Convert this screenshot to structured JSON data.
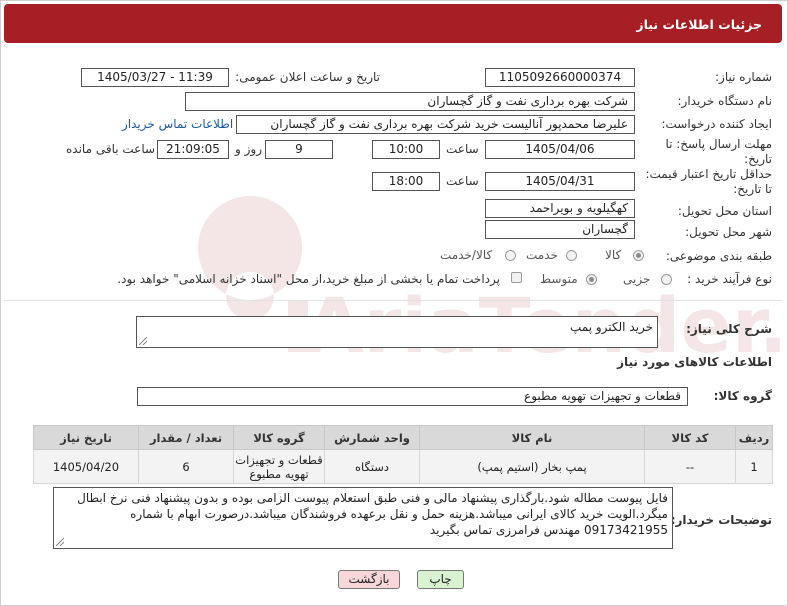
{
  "header": {
    "title": "جزئیات اطلاعات نیاز"
  },
  "labels": {
    "need_number": "شماره نیاز:",
    "announce_datetime": "تاریخ و ساعت اعلان عمومی:",
    "buyer_org": "نام دستگاه خریدار:",
    "creator": "ایجاد کننده درخواست:",
    "reply_deadline": "مهلت ارسال پاسخ: تا تاریخ:",
    "price_validity": "حداقل تاریخ اعتبار قیمت: تا تاریخ:",
    "hour": "ساعت",
    "day_and": "روز و",
    "remaining_hours": "ساعت باقی مانده",
    "province": "استان محل تحویل:",
    "city": "شهر محل تحویل:",
    "category": "طبقه بندی موضوعی:",
    "purchase_type": "نوع فرآیند خرید :",
    "description": "شرح کلی نیاز:",
    "goods_info": "اطلاعات کالاهای مورد نیاز",
    "goods_group": "گروه کالا:",
    "buyer_notes": "توضیحات خریدار:"
  },
  "values": {
    "need_number": "1105092660000374",
    "announce_datetime": "1405/03/27 - 11:39",
    "buyer_org": "شرکت بهره برداری نفت و گاز گچساران",
    "creator": "علیرضا محمدپور آنالیست خرید شرکت بهره برداری نفت و گاز گچساران",
    "buyer_contact_link": "اطلاعات تماس خریدار",
    "reply_date": "1405/04/06",
    "reply_time": "10:00",
    "reply_days": "9",
    "reply_remaining": "21:09:05",
    "price_date": "1405/04/31",
    "price_time": "18:00",
    "province": "کهگیلویه و بویراحمد",
    "city": "گچساران",
    "description": "خرید الکترو پمپ",
    "goods_group": "قطعات و تجهیزات تهویه مطبوع",
    "buyer_notes": "فایل پیوست مطاله شود.بارگذاری پیشنهاد مالی و فنی طبق استعلام پیوست الزامی بوده و بدون پیشنهاد فنی نرخ ابطال میگرد.الویت خرید کالای ایرانی میباشد.هزینه حمل و نقل برعهده فروشندگان میباشد.درصورت ابهام با شماره 09173421955 مهندس فرامرزی تماس بگیرید"
  },
  "category_options": [
    {
      "label": "کالا",
      "selected": true
    },
    {
      "label": "خدمت",
      "selected": false
    },
    {
      "label": "کالا/خدمت",
      "selected": false
    }
  ],
  "purchase_options": [
    {
      "label": "جزیی",
      "selected": false
    },
    {
      "label": "متوسط",
      "selected": true
    }
  ],
  "payment_checkbox": {
    "label": "پرداخت تمام یا بخشی از مبلغ خرید،از محل \"اسناد خزانه اسلامی\" خواهد بود.",
    "checked": false
  },
  "table": {
    "headers": [
      "ردیف",
      "کد کالا",
      "نام کالا",
      "واحد شمارش",
      "گروه کالا",
      "تعداد / مقدار",
      "تاریخ نیاز"
    ],
    "rows": [
      [
        "1",
        "--",
        "پمپ بخار (استیم پمپ)",
        "دستگاه",
        "قطعات و تجهیزات تهویه مطبوع",
        "6",
        "1405/04/20"
      ]
    ]
  },
  "buttons": {
    "print": "چاپ",
    "back": "بازگشت"
  },
  "watermark": "AriaTender.neT",
  "colors": {
    "header_bg": "#a51f25",
    "back_button_bg": "#f8d7d9",
    "print_button_bg": "#d9f2d0"
  }
}
